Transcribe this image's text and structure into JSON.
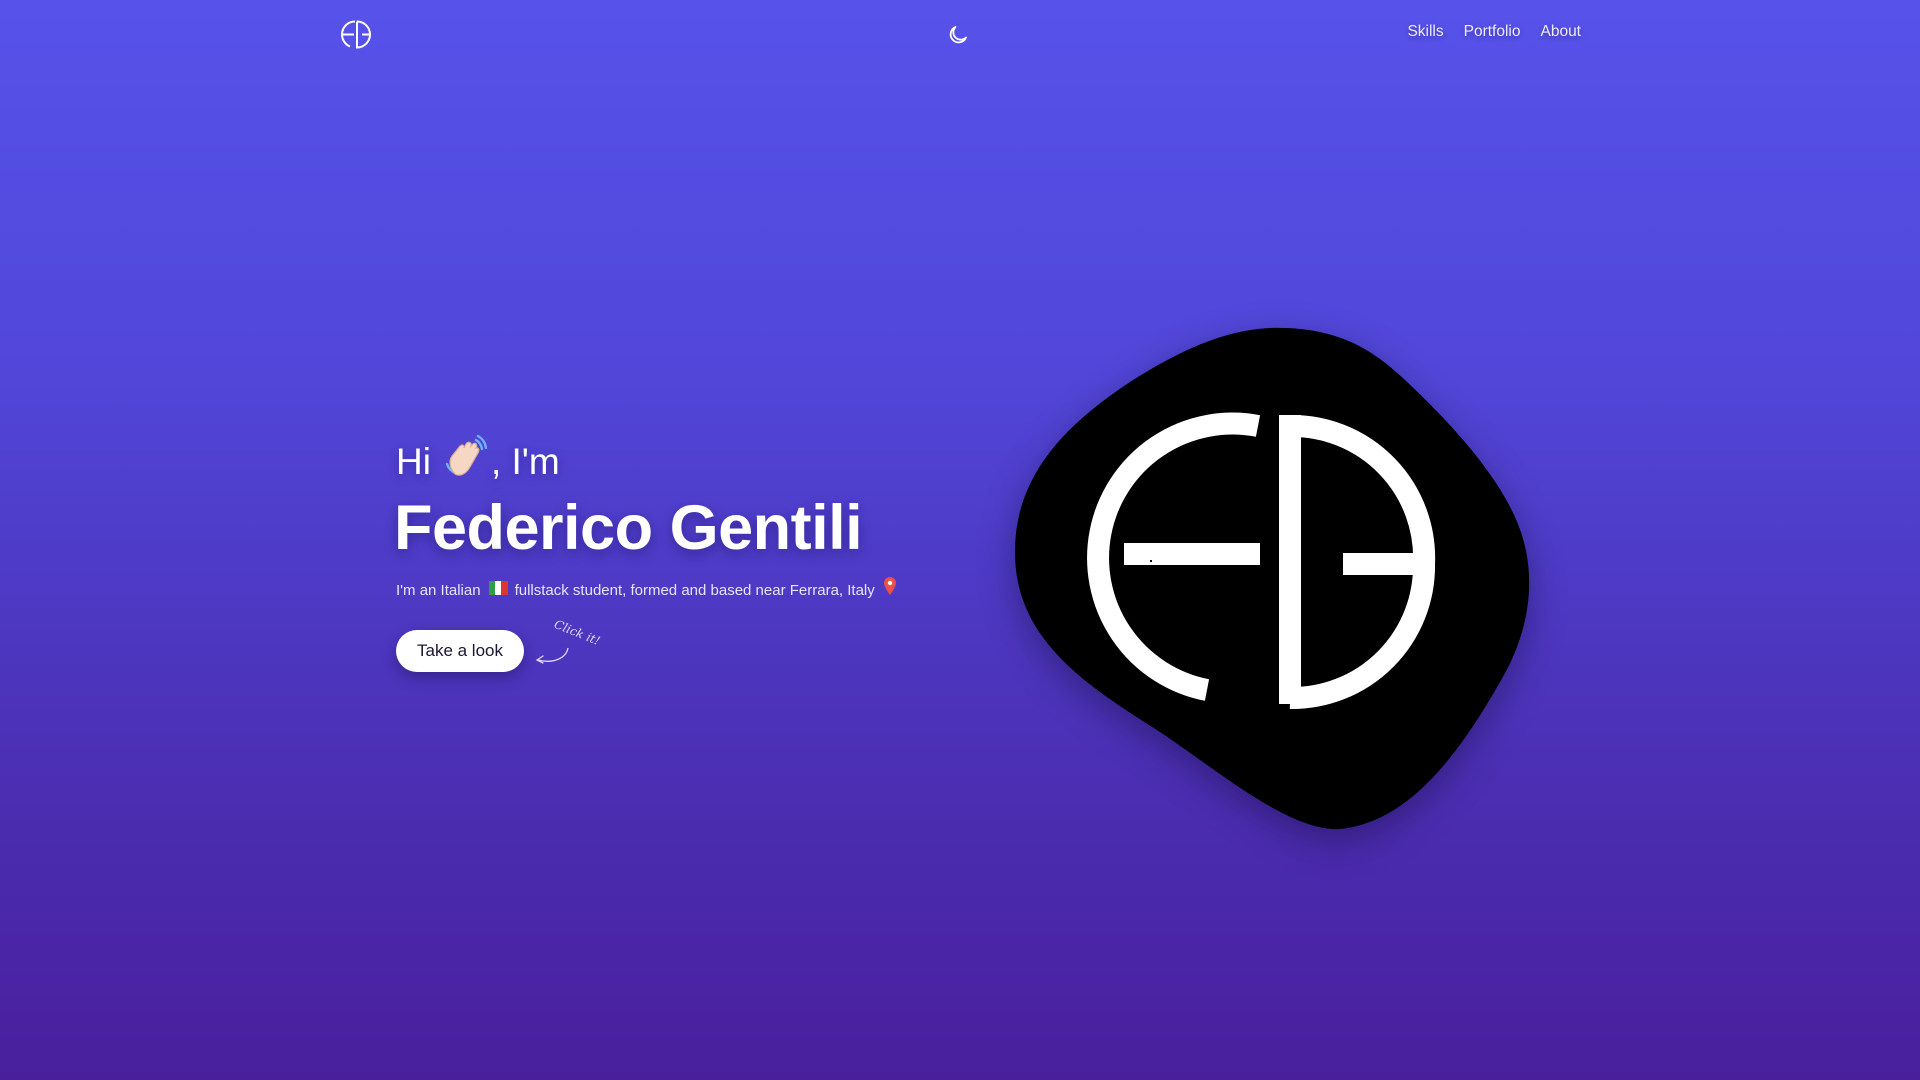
{
  "nav": {
    "logo_icon": "fg-monogram-icon",
    "theme_icon": "moon-icon",
    "links": [
      {
        "label": "Skills"
      },
      {
        "label": "Portfolio"
      },
      {
        "label": "About"
      }
    ]
  },
  "hero": {
    "greeting_before": "Hi",
    "greeting_emoji": "waving-hand-icon",
    "greeting_after": ", I'm",
    "name": "Federico Gentili",
    "bio_before": "I'm an Italian",
    "bio_flag": "italy-flag-icon",
    "bio_after": "fullstack student, formed and based near Ferrara, Italy",
    "bio_pin": "location-pin-icon",
    "cta_label": "Take a look",
    "cta_hint": "Click it!"
  },
  "colors": {
    "background_top": "#5752ea",
    "background_bottom": "#491f9c",
    "blob": "#000000",
    "monogram": "#ffffff",
    "button_bg": "#ffffff",
    "button_text": "#1b1530",
    "pin": "#e8524a"
  }
}
